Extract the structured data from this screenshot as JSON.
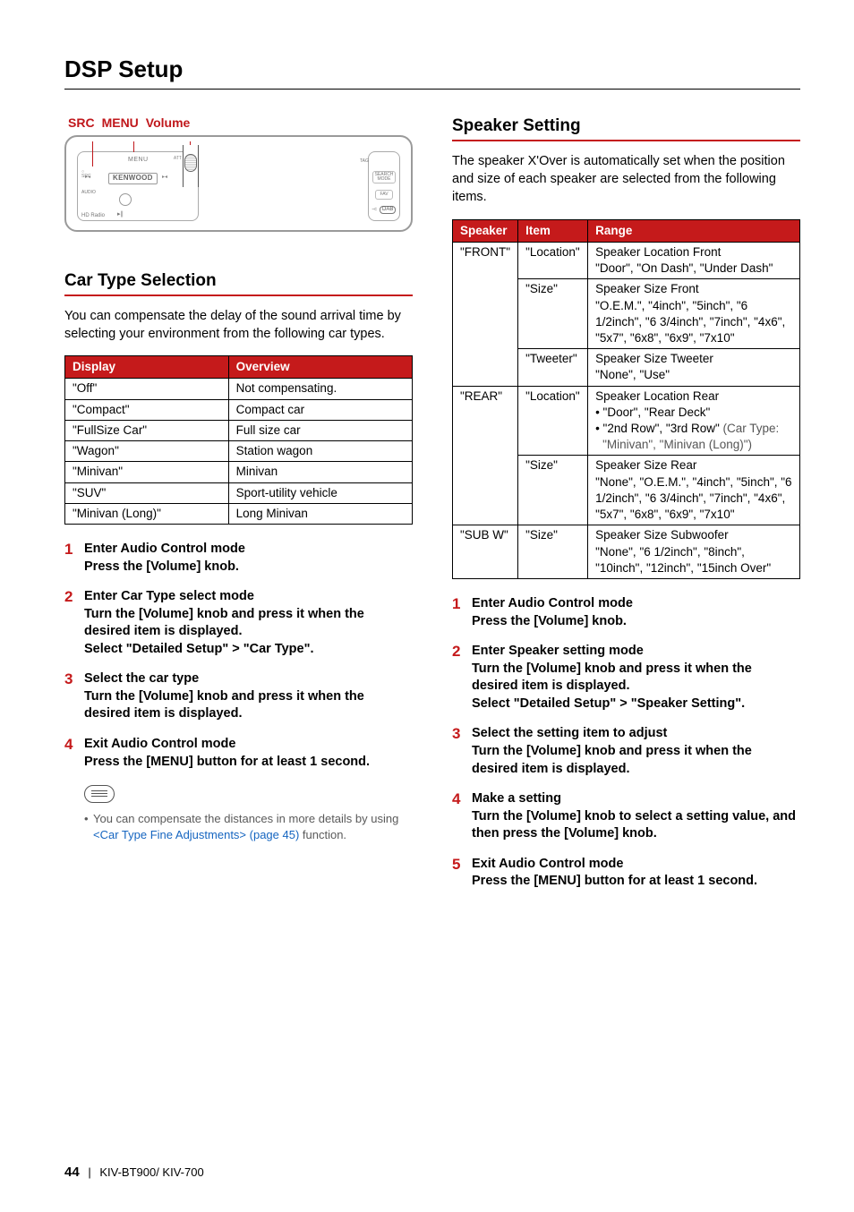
{
  "page_title": "DSP Setup",
  "diagram_labels": {
    "src": "SRC",
    "menu": "MENU",
    "volume": "Volume"
  },
  "device": {
    "menu": "MENU",
    "brand": "KENWOOD",
    "hd": "HD Radio",
    "src_lbl": "SRC",
    "att": "ATT",
    "audio": "AUDIO",
    "search": "SEARCH\nMODE",
    "fav": "FAV",
    "dab": "DAB",
    "tag_side": "TAG"
  },
  "left": {
    "section1_title": "Car Type Selection",
    "section1_intro": "You can compensate the delay of the sound arrival time by selecting your environment from the following car types.",
    "table_headers": {
      "display": "Display",
      "overview": "Overview"
    },
    "table_rows": [
      {
        "display": "\"Off\"",
        "overview": "Not compensating."
      },
      {
        "display": "\"Compact\"",
        "overview": "Compact car"
      },
      {
        "display": "\"FullSize Car\"",
        "overview": "Full size car"
      },
      {
        "display": "\"Wagon\"",
        "overview": "Station wagon"
      },
      {
        "display": "\"Minivan\"",
        "overview": "Minivan"
      },
      {
        "display": "\"SUV\"",
        "overview": "Sport-utility vehicle"
      },
      {
        "display": "\"Minivan (Long)\"",
        "overview": "Long Minivan"
      }
    ],
    "steps": [
      {
        "title": "Enter Audio Control mode",
        "body": "Press the [Volume] knob."
      },
      {
        "title": "Enter Car Type select mode",
        "body": "Turn the [Volume] knob and press it when the desired item is displayed.\nSelect \"Detailed Setup\" > \"Car Type\"."
      },
      {
        "title": "Select the car type",
        "body": "Turn the [Volume] knob and press it when the desired item is displayed."
      },
      {
        "title": "Exit Audio Control mode",
        "body": "Press the [MENU] button for at least 1 second."
      }
    ],
    "note_pre": "You can compensate the distances in more details by using ",
    "note_link": "<Car Type Fine Adjustments> (page 45)",
    "note_post": " function."
  },
  "right": {
    "section1_title": "Speaker Setting",
    "section1_intro": "The speaker X'Over is automatically set when the position and size of each speaker are selected from the following items.",
    "table_headers": {
      "speaker": "Speaker",
      "item": "Item",
      "range": "Range"
    },
    "table_rows": [
      {
        "speaker": "\"FRONT\"",
        "item": "\"Location\"",
        "range": "Speaker Location Front\n\"Door\", \"On Dash\", \"Under Dash\""
      },
      {
        "speaker": "",
        "item": "\"Size\"",
        "range": "Speaker Size Front\n\"O.E.M.\", \"4inch\", \"5inch\", \"6 1/2inch\", \"6 3/4inch\", \"7inch\", \"4x6\", \"5x7\", \"6x8\", \"6x9\", \"7x10\""
      },
      {
        "speaker": "",
        "item": "\"Tweeter\"",
        "range": "Speaker Size Tweeter\n\"None\", \"Use\""
      },
      {
        "speaker": "\"REAR\"",
        "item": "\"Location\"",
        "range_html": true,
        "range_lines": [
          "Speaker Location Rear",
          "• \"Door\", \"Rear Deck\"",
          "• \"2nd Row\", \"3rd Row\" |(Car Type: \"Minivan\", \"Minivan (Long)\")"
        ]
      },
      {
        "speaker": "",
        "item": "\"Size\"",
        "range": "Speaker Size Rear\n\"None\", \"O.E.M.\", \"4inch\", \"5inch\", \"6 1/2inch\", \"6 3/4inch\", \"7inch\", \"4x6\", \"5x7\", \"6x8\", \"6x9\", \"7x10\""
      },
      {
        "speaker": "\"SUB W\"",
        "item": "\"Size\"",
        "range": "Speaker Size Subwoofer\n\"None\", \"6 1/2inch\", \"8inch\", \"10inch\", \"12inch\", \"15inch Over\""
      }
    ],
    "steps": [
      {
        "title": "Enter Audio Control mode",
        "body": "Press the [Volume] knob."
      },
      {
        "title": "Enter Speaker setting mode",
        "body": "Turn the [Volume] knob and press it when the desired item is displayed.\nSelect \"Detailed Setup\" > \"Speaker Setting\"."
      },
      {
        "title": "Select the setting item to adjust",
        "body": "Turn the [Volume] knob and press it when the desired item is displayed."
      },
      {
        "title": "Make a setting",
        "body": "Turn the [Volume] knob to select a setting value, and then press the [Volume] knob."
      },
      {
        "title": "Exit Audio Control mode",
        "body": "Press the [MENU] button for at least 1 second."
      }
    ]
  },
  "footer": {
    "page": "44",
    "model": "KIV-BT900/ KIV-700"
  }
}
